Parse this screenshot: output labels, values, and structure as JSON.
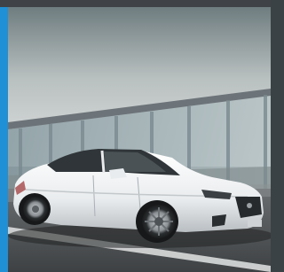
{
  "colors": {
    "accent": "#1f8fd6",
    "top_strip": "#3f4347",
    "sky_top": "#7f8c8e",
    "sky_bottom": "#d8dcdc",
    "road": "#55585a",
    "car_body": "#eef0f1"
  },
  "photo": {
    "subject": "white-sedan",
    "alt": ""
  }
}
